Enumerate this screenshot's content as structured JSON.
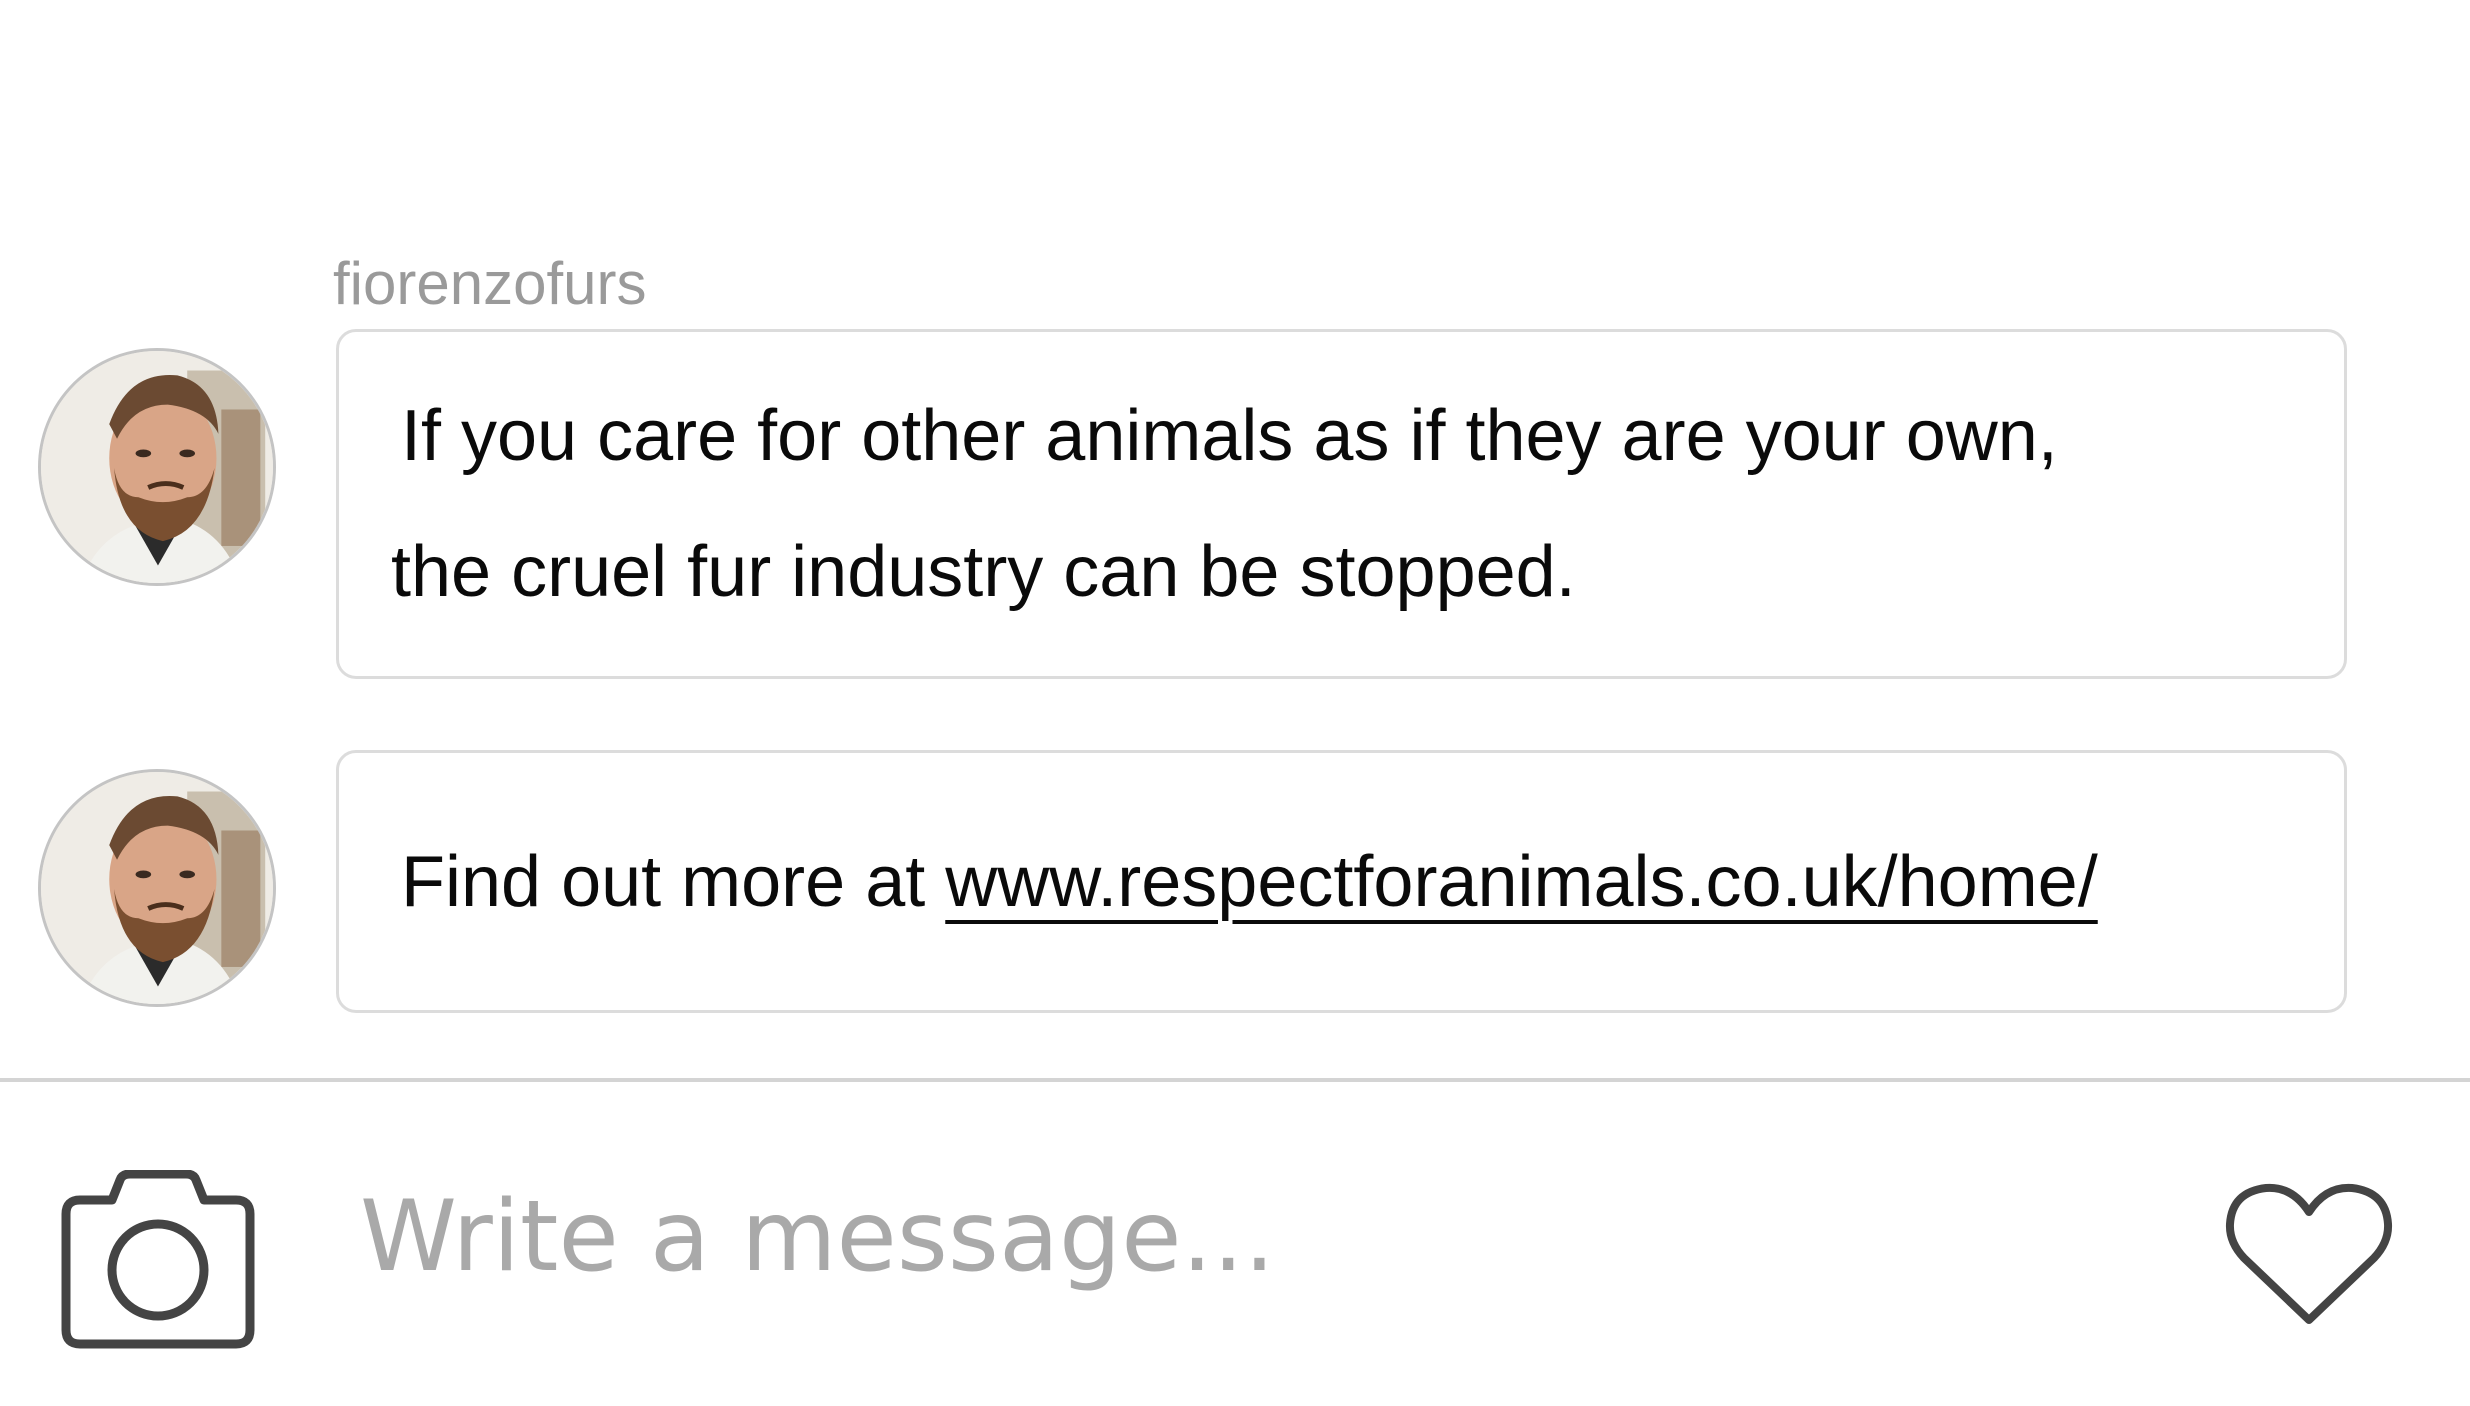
{
  "conversation": {
    "sender": "fiorenzofurs",
    "messages": [
      {
        "line1": "If you care for other animals as if they are your own,",
        "line2": "the cruel fur industry can be stopped."
      },
      {
        "prefix": "Find out more at ",
        "link": "www.respectforanimals.co.uk/home/"
      }
    ]
  },
  "composer": {
    "placeholder": "Write a message...",
    "left_icon": "camera-icon",
    "right_icon": "heart-icon"
  },
  "colors": {
    "background": "#ffffff",
    "bubble_border": "#dcdcdc",
    "sender_name": "#9a9a9a",
    "placeholder": "#a9a9a9",
    "icon_stroke": "#444444",
    "text": "#0a0a0a"
  }
}
